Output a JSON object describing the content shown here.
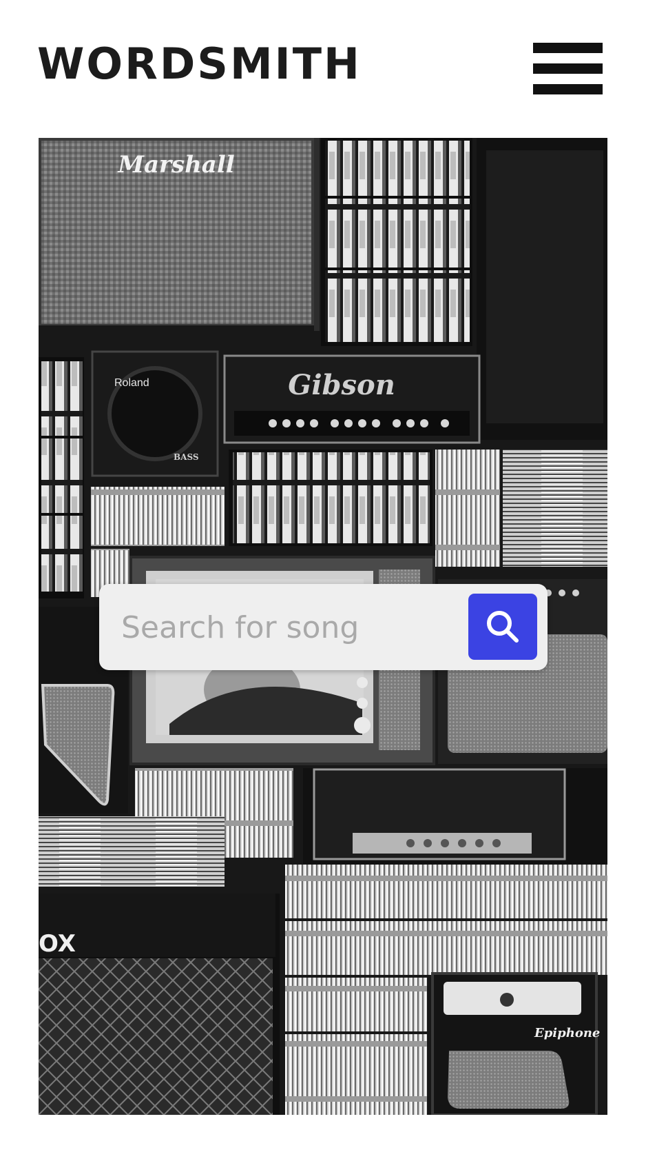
{
  "header": {
    "logo": "WORDSMITH",
    "menu_icon": "hamburger-menu-icon"
  },
  "hero": {
    "brand_labels": {
      "marshall": "Marshall",
      "roland": "Roland",
      "bass": "BASS",
      "gibson": "Gibson",
      "epiphone": "Epiphone",
      "vox": "OX"
    }
  },
  "search": {
    "placeholder": "Search for song",
    "button_icon": "search-icon",
    "button_color": "#3b43e3"
  }
}
